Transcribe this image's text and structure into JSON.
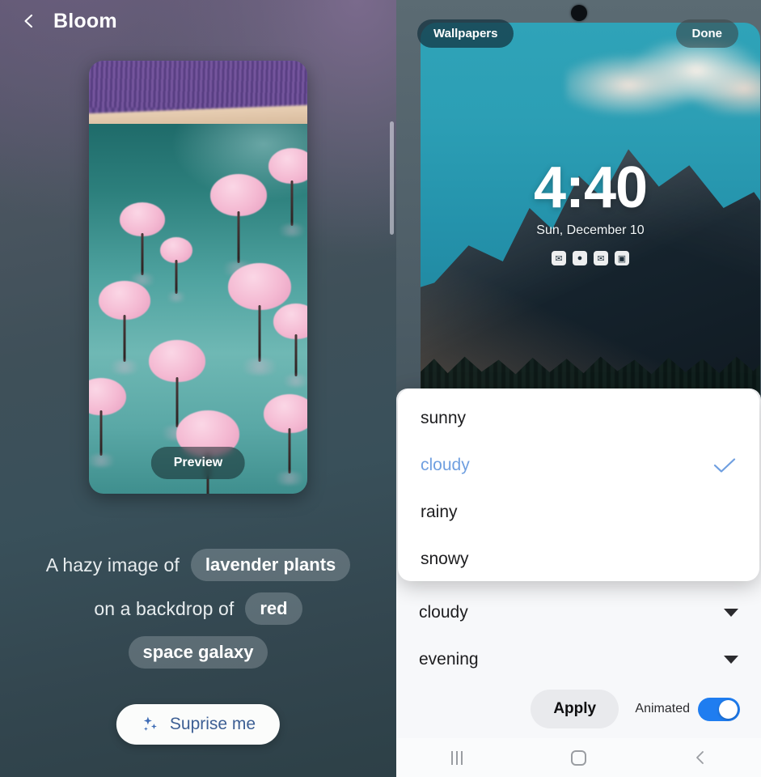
{
  "left": {
    "back_icon": "back-chevron-icon",
    "title": "Bloom",
    "preview_button": "Preview",
    "prompt": {
      "line1_static": "A hazy image of",
      "line1_chip": "lavender plants",
      "line2_static": "on a backdrop of",
      "line2_chip": "red",
      "line3_chip": "space galaxy"
    },
    "surprise": {
      "label": "Suprise me",
      "icon": "sparkles-icon",
      "accent": "#3d5f94"
    }
  },
  "right": {
    "lockscreen": {
      "wallpapers_button": "Wallpapers",
      "done_button": "Done",
      "clock": "4:40",
      "date": "Sun, December 10",
      "notifications": [
        "messages-icon",
        "chat-icon",
        "mail-icon",
        "camera-icon"
      ],
      "notification_glyphs": [
        "✉",
        "●",
        "✉",
        "▣"
      ]
    },
    "dropdown": {
      "open": true,
      "options": [
        {
          "label": "sunny",
          "selected": false
        },
        {
          "label": "cloudy",
          "selected": true
        },
        {
          "label": "rainy",
          "selected": false
        },
        {
          "label": "snowy",
          "selected": false
        }
      ],
      "selected_color": "#6f9fe0"
    },
    "selects": [
      {
        "name": "weather-select",
        "value": "cloudy"
      },
      {
        "name": "time-of-day-select",
        "value": "evening"
      }
    ],
    "actions": {
      "apply_label": "Apply",
      "animated_label": "Animated",
      "animated_on": true,
      "toggle_color": "#1f7df0"
    },
    "navbar": {
      "recents": "recents-icon",
      "home": "home-icon",
      "back": "back-icon"
    }
  }
}
